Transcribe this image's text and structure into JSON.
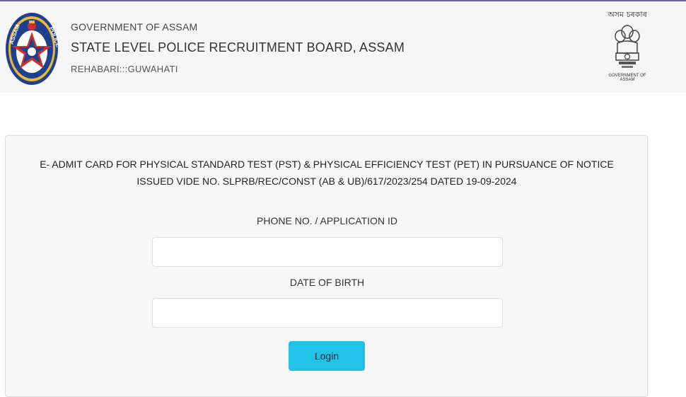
{
  "header": {
    "line1": "GOVERNMENT OF ASSAM",
    "line2": "STATE LEVEL POLICE RECRUITMENT BOARD, ASSAM",
    "line3": "REHABARI:::GUWAHATI",
    "police_logo": {
      "icon": "assam-police-logo-icon",
      "text": "ASSAM POLICE"
    },
    "emblem": {
      "icon": "national-emblem-icon",
      "top_text": "অসম চৰকাৰ",
      "bottom_text": "GOVERNMENT OF ASSAM"
    }
  },
  "form": {
    "notice": "E- ADMIT CARD FOR PHYSICAL STANDARD TEST (PST) & PHYSICAL EFFICIENCY TEST (PET) IN PURSUANCE OF NOTICE ISSUED VIDE NO. SLPRB/REC/CONST (AB & UB)/617/2023/254 DATED 19-09-2024",
    "id_label": "PHONE NO. / APPLICATION ID",
    "id_value": "",
    "dob_label": "DATE OF BIRTH",
    "dob_value": "",
    "login_label": "Login"
  },
  "colors": {
    "accent_button": "#22c1e8",
    "top_line": "#6a64b0",
    "header_bg": "#f6f6f6",
    "card_bg": "#f7f7f7"
  }
}
